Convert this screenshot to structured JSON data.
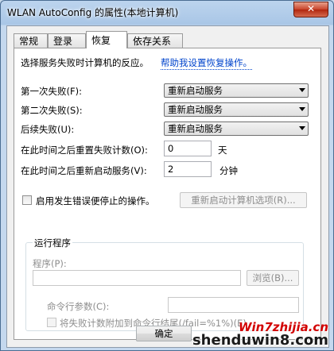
{
  "window": {
    "title": "WLAN AutoConfig 的属性(本地计算机)",
    "close_glyph": "✕"
  },
  "tabs": [
    {
      "label": "常规"
    },
    {
      "label": "登录"
    },
    {
      "label": "恢复"
    },
    {
      "label": "依存关系"
    }
  ],
  "recovery": {
    "intro": "选择服务失败时计算机的反应。",
    "help_link": "帮助我设置恢复操作。",
    "first_failure_label": "第一次失败(F):",
    "first_failure_value": "重新启动服务",
    "second_failure_label": "第二次失败(S):",
    "second_failure_value": "重新启动服务",
    "subsequent_label": "后续失败(U):",
    "subsequent_value": "重新启动服务",
    "reset_count_label": "在此时间之后重置失败计数(O):",
    "reset_count_value": "0",
    "reset_count_unit": "天",
    "restart_after_label": "在此时间之后重新启动服务(V):",
    "restart_after_value": "2",
    "restart_after_unit": "分钟",
    "stop_with_errors_label": "启用发生错误便停止的操作。",
    "restart_options_button": "重新启动计算机选项(R)..."
  },
  "run_program": {
    "group_title": "运行程序",
    "program_label": "程序(P):",
    "program_value": "",
    "browse_button": "浏览(B)...",
    "params_label": "命令行参数(C):",
    "params_value": "",
    "append_fail_count_label": "将失败计数附加到命令行结尾(/fail=%1%)(E)"
  },
  "footer": {
    "ok_button": "确定"
  },
  "watermark": {
    "line1": "Win7zhijia.cn",
    "line2": "shenduwin8.com"
  }
}
